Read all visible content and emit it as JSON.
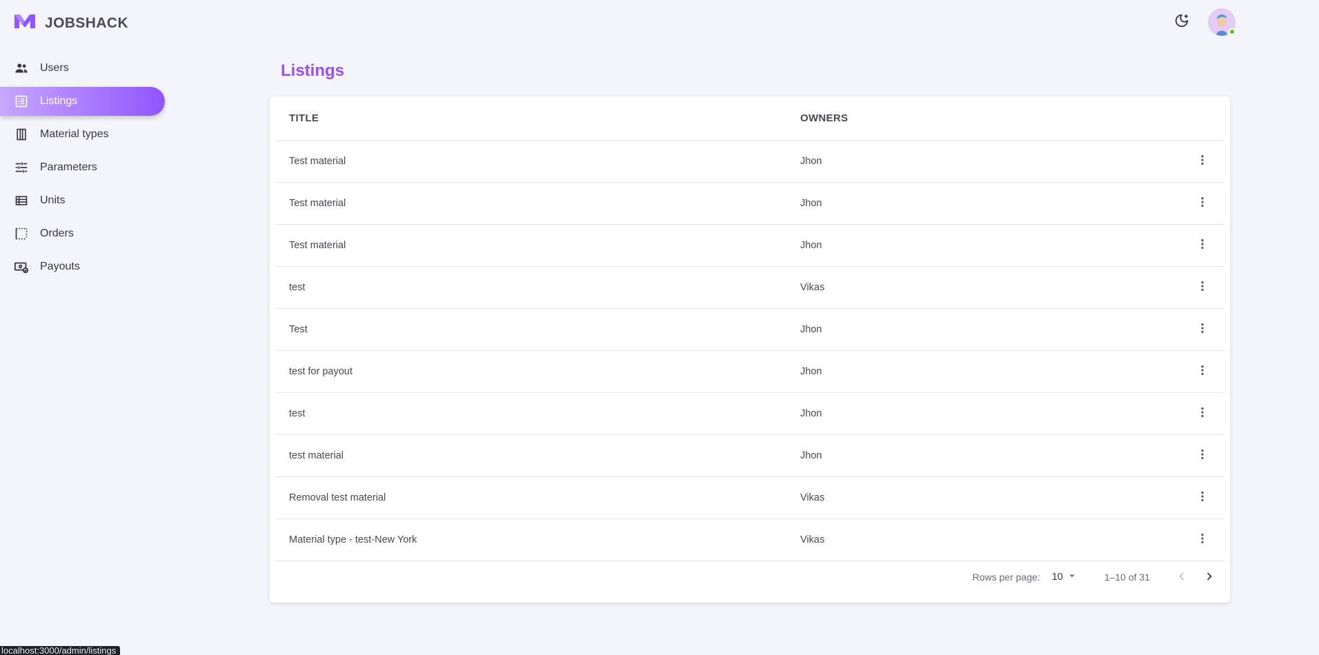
{
  "app": {
    "brand": "JOBSHACK",
    "brand_color": "#9155fd"
  },
  "sidebar": {
    "items": [
      {
        "label": "Users",
        "icon": "users-icon",
        "active": false
      },
      {
        "label": "Listings",
        "icon": "list-icon",
        "active": true
      },
      {
        "label": "Material types",
        "icon": "columns-icon",
        "active": false
      },
      {
        "label": "Parameters",
        "icon": "sliders-icon",
        "active": false
      },
      {
        "label": "Units",
        "icon": "table-icon",
        "active": false
      },
      {
        "label": "Orders",
        "icon": "dotted-square-icon",
        "active": false
      },
      {
        "label": "Payouts",
        "icon": "cash-check-icon",
        "active": false
      }
    ]
  },
  "header": {
    "theme_toggle_icon": "moon-star-icon",
    "avatar_status": "online"
  },
  "main": {
    "title": "Listings",
    "table": {
      "columns": [
        "TITLE",
        "OWNERS"
      ],
      "rows": [
        {
          "title": "Test material",
          "owner": "Jhon"
        },
        {
          "title": "Test material",
          "owner": "Jhon"
        },
        {
          "title": "Test material",
          "owner": "Jhon"
        },
        {
          "title": "test",
          "owner": "Vikas"
        },
        {
          "title": "Test",
          "owner": "Jhon"
        },
        {
          "title": "test for payout",
          "owner": "Jhon"
        },
        {
          "title": "test",
          "owner": "Jhon"
        },
        {
          "title": "test material",
          "owner": "Jhon"
        },
        {
          "title": "Removal test material",
          "owner": "Vikas"
        },
        {
          "title": "Material type - test-New York",
          "owner": "Vikas"
        }
      ]
    },
    "pagination": {
      "rows_per_page_label": "Rows per page:",
      "rows_per_page": "10",
      "range": "1–10 of 31"
    }
  },
  "status_bar": {
    "url": "localhost:3000/admin/listings"
  }
}
